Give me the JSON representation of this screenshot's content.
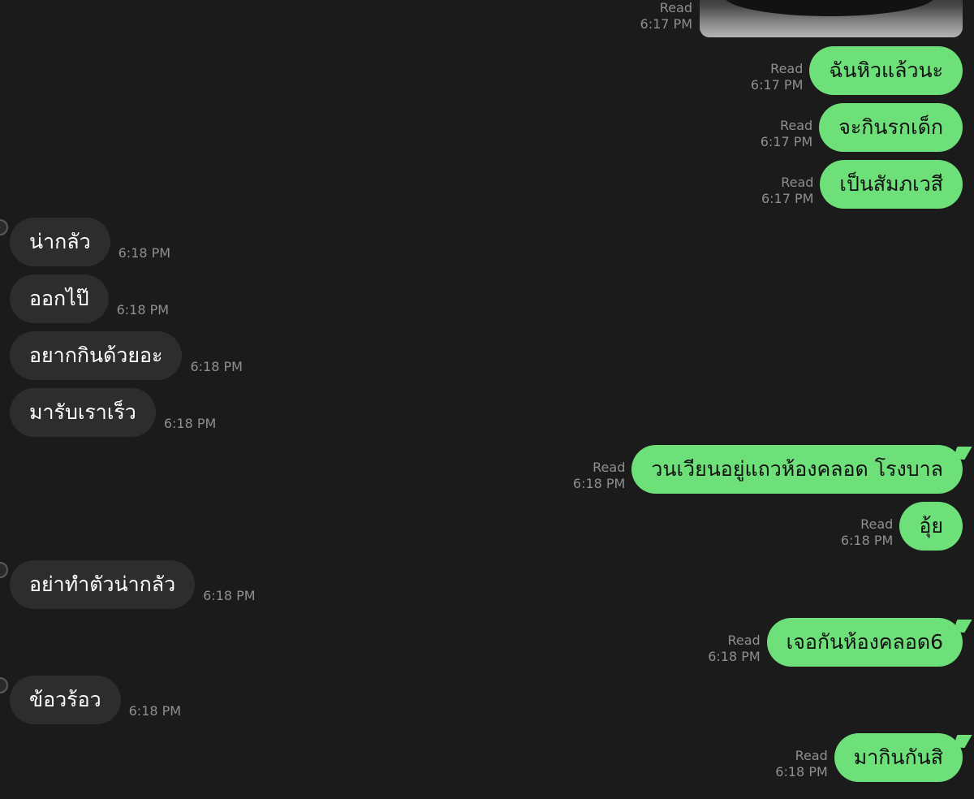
{
  "chat": {
    "photo_message": {
      "status": "Read",
      "time": "6:17 PM"
    },
    "messages": [
      {
        "dir": "out",
        "text": "ฉันหิวแล้วนะ",
        "status": "Read",
        "time": "6:17 PM"
      },
      {
        "dir": "out",
        "text": "จะกินรกเด็ก",
        "status": "Read",
        "time": "6:17 PM"
      },
      {
        "dir": "out",
        "text": "เป็นสัมภเวสี",
        "status": "Read",
        "time": "6:17 PM"
      },
      {
        "dir": "in",
        "text": "น่ากลัว",
        "time": "6:18 PM"
      },
      {
        "dir": "in",
        "text": "ออกไป๊",
        "time": "6:18 PM"
      },
      {
        "dir": "in",
        "text": "อยากกินด้วยอะ",
        "time": "6:18 PM"
      },
      {
        "dir": "in",
        "text": "มารับเราเร็ว",
        "time": "6:18 PM"
      },
      {
        "dir": "out",
        "text": "วนเวียนอยู่แถวห้องคลอด โรงบาล",
        "status": "Read",
        "time": "6:18 PM"
      },
      {
        "dir": "out",
        "text": "อุ้ย",
        "status": "Read",
        "time": "6:18 PM"
      },
      {
        "dir": "in",
        "text": "อย่าทำตัวน่ากลัว",
        "time": "6:18 PM"
      },
      {
        "dir": "out",
        "text": "เจอกันห้องคลอด6",
        "status": "Read",
        "time": "6:18 PM"
      },
      {
        "dir": "in",
        "text": "ข้อวร้อว",
        "time": "6:18 PM"
      },
      {
        "dir": "out",
        "text": "มากินกันสิ",
        "status": "Read",
        "time": "6:18 PM"
      }
    ]
  }
}
